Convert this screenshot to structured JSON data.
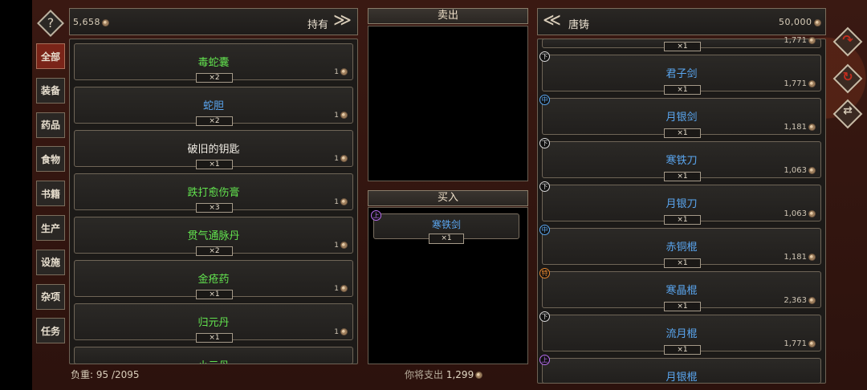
{
  "header_left": {
    "money": "5,658",
    "held_label": "持有",
    "arrow": "≫"
  },
  "header_right": {
    "arrow": "≪",
    "shop_name": "唐铸",
    "money": "50,000"
  },
  "help": {
    "label": "?"
  },
  "categories": [
    "全部",
    "装备",
    "药品",
    "食物",
    "书籍",
    "生产",
    "设施",
    "杂项",
    "任务"
  ],
  "inventory": [
    {
      "name": "毒蛇囊",
      "qty": "×2",
      "count": "1",
      "color": "green"
    },
    {
      "name": "蛇胆",
      "qty": "×2",
      "count": "1",
      "color": "blue"
    },
    {
      "name": "破旧的钥匙",
      "qty": "×1",
      "count": "1",
      "color": "white"
    },
    {
      "name": "跌打愈伤膏",
      "qty": "×3",
      "count": "1",
      "color": "green"
    },
    {
      "name": "贯气通脉丹",
      "qty": "×2",
      "count": "1",
      "color": "green"
    },
    {
      "name": "金疮药",
      "qty": "×1",
      "count": "1",
      "color": "green"
    },
    {
      "name": "归元丹",
      "qty": "×1",
      "count": "1",
      "color": "green"
    },
    {
      "name": "小元丹",
      "qty": "",
      "count": "",
      "color": "green"
    }
  ],
  "sell_section": {
    "title": "卖出"
  },
  "buy_section": {
    "title": "买入",
    "item": {
      "name": "寒铁剑",
      "qty": "×1",
      "tier": "上"
    }
  },
  "shop_items": [
    {
      "name": "",
      "qty": "×1",
      "price": "1,771",
      "tier": ""
    },
    {
      "name": "君子剑",
      "qty": "×1",
      "price": "1,771",
      "tier": "下"
    },
    {
      "name": "月银剑",
      "qty": "×1",
      "price": "1,181",
      "tier": "中"
    },
    {
      "name": "寒铁刀",
      "qty": "×1",
      "price": "1,063",
      "tier": "下"
    },
    {
      "name": "月银刀",
      "qty": "×1",
      "price": "1,063",
      "tier": "下"
    },
    {
      "name": "赤铜棍",
      "qty": "×1",
      "price": "1,181",
      "tier": "中"
    },
    {
      "name": "寒晶棍",
      "qty": "×1",
      "price": "2,363",
      "tier": "特"
    },
    {
      "name": "流月棍",
      "qty": "×1",
      "price": "1,771",
      "tier": "下"
    },
    {
      "name": "月银棍",
      "qty": "",
      "price": "",
      "tier": "上"
    }
  ],
  "footer": {
    "weight_label": "负重:",
    "weight_value": "95 /2095",
    "spend_label": "你将支出",
    "spend_value": "1,299"
  },
  "colors": {
    "green": "#62e24f",
    "blue": "#5aa6f0",
    "white": "#f0ece4",
    "accent_red": "#7a2418"
  }
}
